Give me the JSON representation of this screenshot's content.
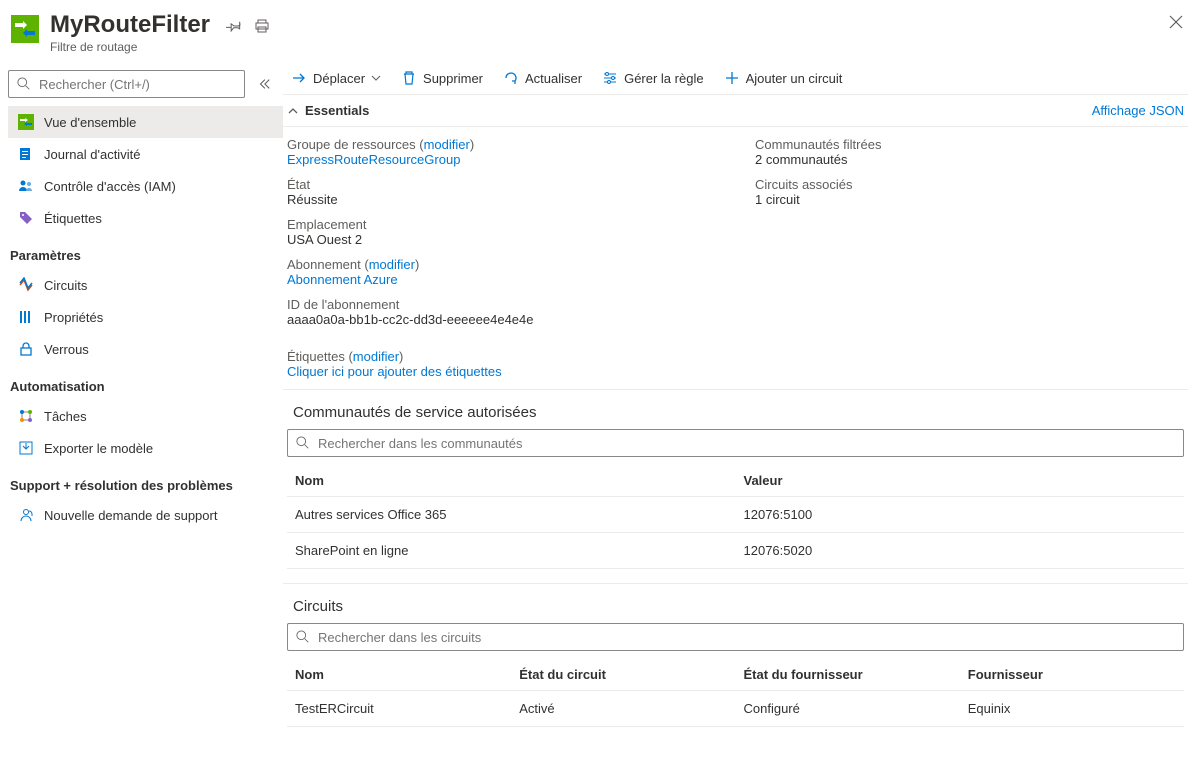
{
  "header": {
    "title": "MyRouteFilter",
    "subtitle": "Filtre de routage"
  },
  "sidebar": {
    "search_placeholder": "Rechercher (Ctrl+/)",
    "items_top": [
      {
        "label": "Vue d'ensemble",
        "id": "overview"
      },
      {
        "label": "Journal d'activité",
        "id": "activity"
      },
      {
        "label": "Contrôle d'accès (IAM)",
        "id": "iam"
      },
      {
        "label": "Étiquettes",
        "id": "tags"
      }
    ],
    "section_settings": "Paramètres",
    "items_settings": [
      {
        "label": "Circuits",
        "id": "circuits"
      },
      {
        "label": "Propriétés",
        "id": "properties"
      },
      {
        "label": "Verrous",
        "id": "locks"
      }
    ],
    "section_automation": "Automatisation",
    "items_automation": [
      {
        "label": "Tâches",
        "id": "tasks"
      },
      {
        "label": "Exporter le modèle",
        "id": "export"
      }
    ],
    "section_support": "Support + résolution des problèmes",
    "items_support": [
      {
        "label": "Nouvelle demande de support",
        "id": "support"
      }
    ]
  },
  "toolbar": {
    "move": "Déplacer",
    "delete": "Supprimer",
    "refresh": "Actualiser",
    "manage_rule": "Gérer la règle",
    "add_circuit": "Ajouter un circuit"
  },
  "essentials": {
    "header": "Essentials",
    "json_view": "Affichage JSON",
    "modify": "modifier",
    "left": {
      "resource_group_label": "Groupe de ressources",
      "resource_group_value": "ExpressRouteResourceGroup",
      "status_label": "État",
      "status_value": "Réussite",
      "location_label": "Emplacement",
      "location_value": "USA Ouest 2",
      "subscription_label": "Abonnement",
      "subscription_value": "Abonnement Azure",
      "subscription_id_label": "ID de l'abonnement",
      "subscription_id_value": "aaaa0a0a-bb1b-cc2c-dd3d-eeeeee4e4e4e"
    },
    "right": {
      "filtered_communities_label": "Communautés filtrées",
      "filtered_communities_value": "2 communautés",
      "associated_circuits_label": "Circuits associés",
      "associated_circuits_value": "1 circuit"
    },
    "tags_label": "Étiquettes",
    "tags_value": "Cliquer ici pour ajouter des étiquettes"
  },
  "communities": {
    "title": "Communautés de service autorisées",
    "search_placeholder": "Rechercher dans les communautés",
    "col_name": "Nom",
    "col_value": "Valeur",
    "rows": [
      {
        "name": "Autres services Office 365",
        "value": "12076:5100"
      },
      {
        "name": "SharePoint en ligne",
        "value": "12076:5020"
      }
    ]
  },
  "circuits": {
    "title": "Circuits",
    "search_placeholder": "Rechercher dans les circuits",
    "col_name": "Nom",
    "col_circuit_state": "État du circuit",
    "col_provider_state": "État du fournisseur",
    "col_provider": "Fournisseur",
    "rows": [
      {
        "name": "TestERCircuit",
        "circuit_state": "Activé",
        "provider_state": "Configuré",
        "provider": "Equinix"
      }
    ]
  }
}
